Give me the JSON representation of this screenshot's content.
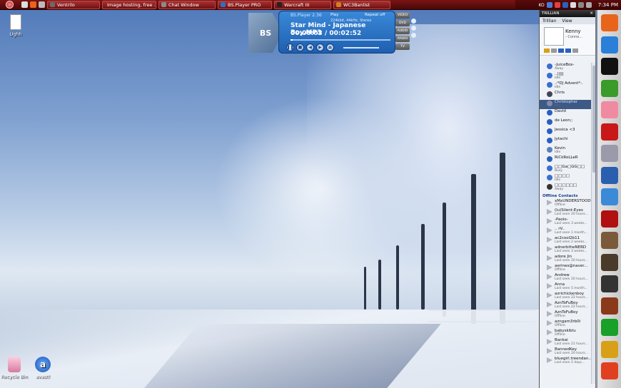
{
  "taskbar": {
    "windows": [
      {
        "label": "Ventrilo",
        "color": "#6a6a6a"
      },
      {
        "label": "Image hosting, free ...",
        "color": "#e07020"
      },
      {
        "label": "Chat Window",
        "color": "#7a7a7a"
      },
      {
        "label": "BS.Player PRO",
        "color": "#2f6fc0"
      },
      {
        "label": "Warcraft III",
        "color": "#222222"
      },
      {
        "label": "WC3Banlist",
        "color": "#d08020"
      }
    ],
    "tray_text": "KO",
    "clock": "7:34 PM"
  },
  "desktop": {
    "icons": [
      {
        "label": "Ughh"
      },
      {
        "label": "Recycle Bin"
      },
      {
        "label": "avast!"
      }
    ]
  },
  "bsplayer": {
    "title": "BS.Player 2.36",
    "state": "Play",
    "repeat": "Repeat off",
    "info": "224kbit, 44kHz, Stereo",
    "song": "Star Mind - Japanese Boy.MP3",
    "time": "00:00:03 / 00:02:52",
    "progress": 0.02,
    "logo": "BS",
    "side_buttons": [
      "VIDEO",
      "DVD",
      "AUDIO",
      "RADIO",
      "TV"
    ],
    "controls": [
      "pause",
      "stop",
      "prev",
      "next",
      "eject"
    ]
  },
  "trillian": {
    "title": "TRILLIAN",
    "menu": [
      "Trillian",
      "View"
    ],
    "profile_name": "Kenny",
    "profile_status": "- Conne...",
    "contacts": [
      {
        "name": "-JuiceBox-",
        "sub": "Away",
        "icon": "#3a6fd0"
      },
      {
        "name": "..|||||",
        "sub": "Idle",
        "icon": "#3a6fd0"
      },
      {
        "name": ".:*DJ Advent*:.",
        "sub": "Idle",
        "icon": "#3a6fd0"
      },
      {
        "name": "Chris",
        "sub": "",
        "icon": "#445"
      },
      {
        "name": "Christopher",
        "sub": "Idle",
        "icon": "#88a",
        "selected": true
      },
      {
        "name": "David",
        "sub": "",
        "icon": "#2a5fc0"
      },
      {
        "name": "de Leon;;",
        "sub": "",
        "icon": "#2a5fc0"
      },
      {
        "name": "Jessica <3",
        "sub": "",
        "icon": "#2a5fc0"
      },
      {
        "name": "Jytachi",
        "sub": "",
        "icon": "#2a5fc0"
      },
      {
        "name": "Kevin",
        "sub": "Idle",
        "icon": "#5a7fc0"
      },
      {
        "name": "RiCkRoLLeR",
        "sub": "",
        "icon": "#2a5fc0"
      },
      {
        "name": "□□Ga□GG□□",
        "sub": "Busy",
        "icon": "#3a6fd0"
      },
      {
        "name": "□□□□",
        "sub": "Idle",
        "icon": "#3a6fd0"
      },
      {
        "name": "□□□□□□",
        "sub": "Away",
        "icon": "#333"
      }
    ],
    "offline_group": "Offline Contacts",
    "offline": [
      {
        "name": "xMxUNDERSTOOD",
        "sub": "Offline"
      },
      {
        "name": "(lu)Silent-Eyes",
        "sub": "Last seen 20 hours..."
      },
      {
        "name": "-Paolo-",
        "sub": "Last seen 3 weeks..."
      },
      {
        "name": ".. rV..",
        "sub": "Last seen 1 month..."
      },
      {
        "name": "ac2cool2b11",
        "sub": "Last seen 2 weeks..."
      },
      {
        "name": "adnerbtheNERD",
        "sub": "Last seen 3 weeks..."
      },
      {
        "name": "adore Jin",
        "sub": "Last seen 20 hours..."
      },
      {
        "name": "aerines@naver...",
        "sub": "Offline"
      },
      {
        "name": "Andrew",
        "sub": "Last seen 20 hours..."
      },
      {
        "name": "Anna",
        "sub": "Last seen 5 month..."
      },
      {
        "name": "azrichickenboy",
        "sub": "Last seen 22 hours..."
      },
      {
        "name": "AznToFuBoy",
        "sub": "Last seen 22 hours..."
      },
      {
        "name": "AznToFuBoy",
        "sub": "Offline"
      },
      {
        "name": "azngam3rb0i",
        "sub": "Offline"
      },
      {
        "name": "babyskiblu",
        "sub": "Offline"
      },
      {
        "name": "Bankai",
        "sub": "Last seen 21 hours..."
      },
      {
        "name": "BannedKey",
        "sub": "Last seen 20 hours..."
      },
      {
        "name": "bluegirl.treendan...",
        "sub": "Last seen 2 days..."
      }
    ]
  },
  "dock": {
    "icons": [
      {
        "name": "firefox-icon",
        "color": "#e8641a"
      },
      {
        "name": "ie-icon",
        "color": "#2a7fd8"
      },
      {
        "name": "steam-icon",
        "color": "#111111"
      },
      {
        "name": "utorrent-icon",
        "color": "#3a9a2a"
      },
      {
        "name": "pink-app-icon",
        "color": "#f08aa0"
      },
      {
        "name": "red-arrow-icon",
        "color": "#c81818"
      },
      {
        "name": "quicktime-icon",
        "color": "#9a9aaa"
      },
      {
        "name": "lightning-icon",
        "color": "#2a5fb0"
      },
      {
        "name": "itunes-icon",
        "color": "#3a8ad8"
      },
      {
        "name": "gamespy-icon",
        "color": "#b01010"
      },
      {
        "name": "jet-icon",
        "color": "#7a5a3a"
      },
      {
        "name": "warcraft-icon",
        "color": "#4a3a2a"
      },
      {
        "name": "e-app-icon",
        "color": "#333333"
      },
      {
        "name": "character-icon",
        "color": "#8a3a1a"
      },
      {
        "name": "star-icon",
        "color": "#18a028"
      },
      {
        "name": "wc3-icon",
        "color": "#d8a018"
      },
      {
        "name": "messenger-icon",
        "color": "#e04020"
      }
    ]
  }
}
